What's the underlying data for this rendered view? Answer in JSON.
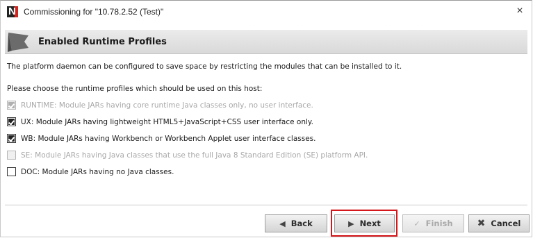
{
  "window": {
    "title": "Commissioning for \"10.78.2.52 (Test)\"",
    "close_glyph": "×"
  },
  "header": {
    "title": "Enabled Runtime Profiles",
    "icon": "flag-icon"
  },
  "content": {
    "description": "The platform daemon can be configured to save space by restricting the modules that can be installed to it.",
    "prompt": "Please choose the runtime profiles which should be used on this host:",
    "options": [
      {
        "label": "RUNTIME: Module JARs having core runtime Java classes only, no user interface.",
        "checked": true,
        "enabled": false
      },
      {
        "label": "UX: Module JARs having lightweight HTML5+JavaScript+CSS user interface only.",
        "checked": true,
        "enabled": true
      },
      {
        "label": "WB: Module JARs having Workbench or Workbench Applet user interface classes.",
        "checked": true,
        "enabled": true
      },
      {
        "label": "SE: Module JARs having Java classes that use the full Java 8 Standard Edition (SE) platform API.",
        "checked": false,
        "enabled": false
      },
      {
        "label": "DOC: Module JARs having no Java classes.",
        "checked": false,
        "enabled": true
      }
    ]
  },
  "footer": {
    "back_label": "Back",
    "next_label": "Next",
    "finish_label": "Finish",
    "cancel_label": "Cancel",
    "highlight_color": "#d5161a"
  }
}
